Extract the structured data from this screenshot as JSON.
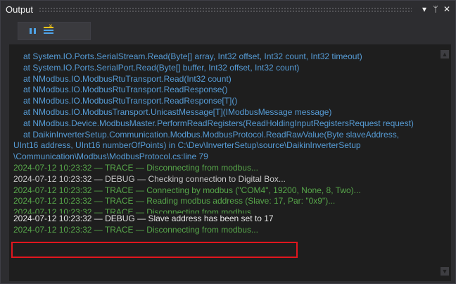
{
  "window": {
    "title": "Output",
    "dropdown_glyph": "▾",
    "pin_glyph": "ᛘ",
    "close_glyph": "✕"
  },
  "output": {
    "lines": [
      {
        "text": "at System.IO.Ports.SerialStream.Read(Byte[] array, Int32 offset, Int32 count, Int32 timeout)",
        "style": "blue",
        "indent": true
      },
      {
        "text": "at System.IO.Ports.SerialPort.Read(Byte[] buffer, Int32 offset, Int32 count)",
        "style": "blue",
        "indent": true
      },
      {
        "text": "at NModbus.IO.ModbusRtuTransport.Read(Int32 count)",
        "style": "blue",
        "indent": true
      },
      {
        "text": "at NModbus.IO.ModbusRtuTransport.ReadResponse()",
        "style": "blue",
        "indent": true
      },
      {
        "text": "at NModbus.IO.ModbusRtuTransport.ReadResponse[T]()",
        "style": "blue",
        "indent": true
      },
      {
        "text": "at NModbus.IO.ModbusTransport.UnicastMessage[T](IModbusMessage message)",
        "style": "blue",
        "indent": true
      },
      {
        "text": "at NModbus.Device.ModbusMaster.PerformReadRegisters(ReadHoldingInputRegistersRequest request)",
        "style": "blue",
        "indent": true
      },
      {
        "text": "at DaikinInverterSetup.Communication.Modbus.ModbusProtocol.ReadRawValue(Byte slaveAddress,",
        "style": "blue",
        "indent": true
      },
      {
        "text": "UInt16 address, UInt16 numberOfPoints) in C:\\Dev\\InverterSetup\\source\\DaikinInverterSetup",
        "style": "blue",
        "indent": false
      },
      {
        "text": "\\Communication\\Modbus\\ModbusProtocol.cs:line 79",
        "style": "blue",
        "indent": false
      },
      {
        "text": "2024-07-12 10:23:32 — TRACE — Disconnecting from modbus...",
        "style": "green",
        "indent": false
      },
      {
        "text": "2024-07-12 10:23:32 — DEBUG — Checking connection to Digital Box...",
        "style": "gray",
        "indent": false
      },
      {
        "text": "2024-07-12 10:23:32 — TRACE — Connecting by modbus (\"COM4\", 19200, None, 8, Two)...",
        "style": "green",
        "indent": false
      },
      {
        "text": "2024-07-12 10:23:32 — TRACE — Reading modbus address (Slave: 17, Par: \"0x9\")...",
        "style": "green",
        "indent": false
      },
      {
        "text": "2024-07-12 10:23:32 — TRACE — Disconnecting from modbus...",
        "style": "green",
        "indent": false,
        "clipped": true
      },
      {
        "text": "2024-07-12 10:23:32 — DEBUG — Slave address has been set to 17",
        "style": "white",
        "indent": false
      },
      {
        "text": "2024-07-12 10:23:32 — TRACE — Disconnecting from modbus...",
        "style": "green",
        "indent": false
      }
    ]
  },
  "colors": {
    "trace_green": "#57a64a",
    "stack_blue": "#569cd6",
    "debug_gray": "#c8c8c8",
    "highlight_red": "#e0161e"
  }
}
